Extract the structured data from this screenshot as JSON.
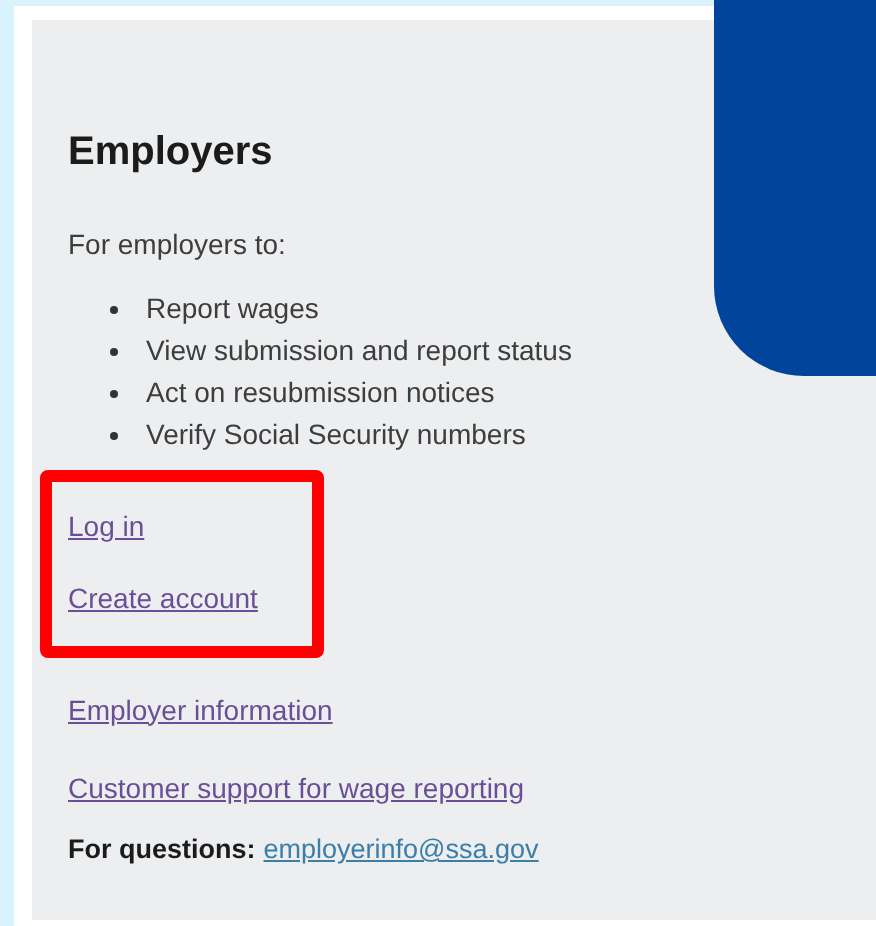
{
  "section": {
    "title": "Employers",
    "intro": "For employers to:",
    "bullets": [
      "Report wages",
      "View submission and report status",
      "Act on resubmission notices",
      "Verify Social Security numbers"
    ],
    "links": [
      {
        "label": "Log in",
        "highlighted": true
      },
      {
        "label": "Create account",
        "highlighted": true
      },
      {
        "label": "Employer information",
        "highlighted": false
      },
      {
        "label": "Customer support for wage reporting",
        "highlighted": false
      }
    ],
    "questions": {
      "label": "For questions:",
      "email": "employerinfo@ssa.gov"
    }
  }
}
